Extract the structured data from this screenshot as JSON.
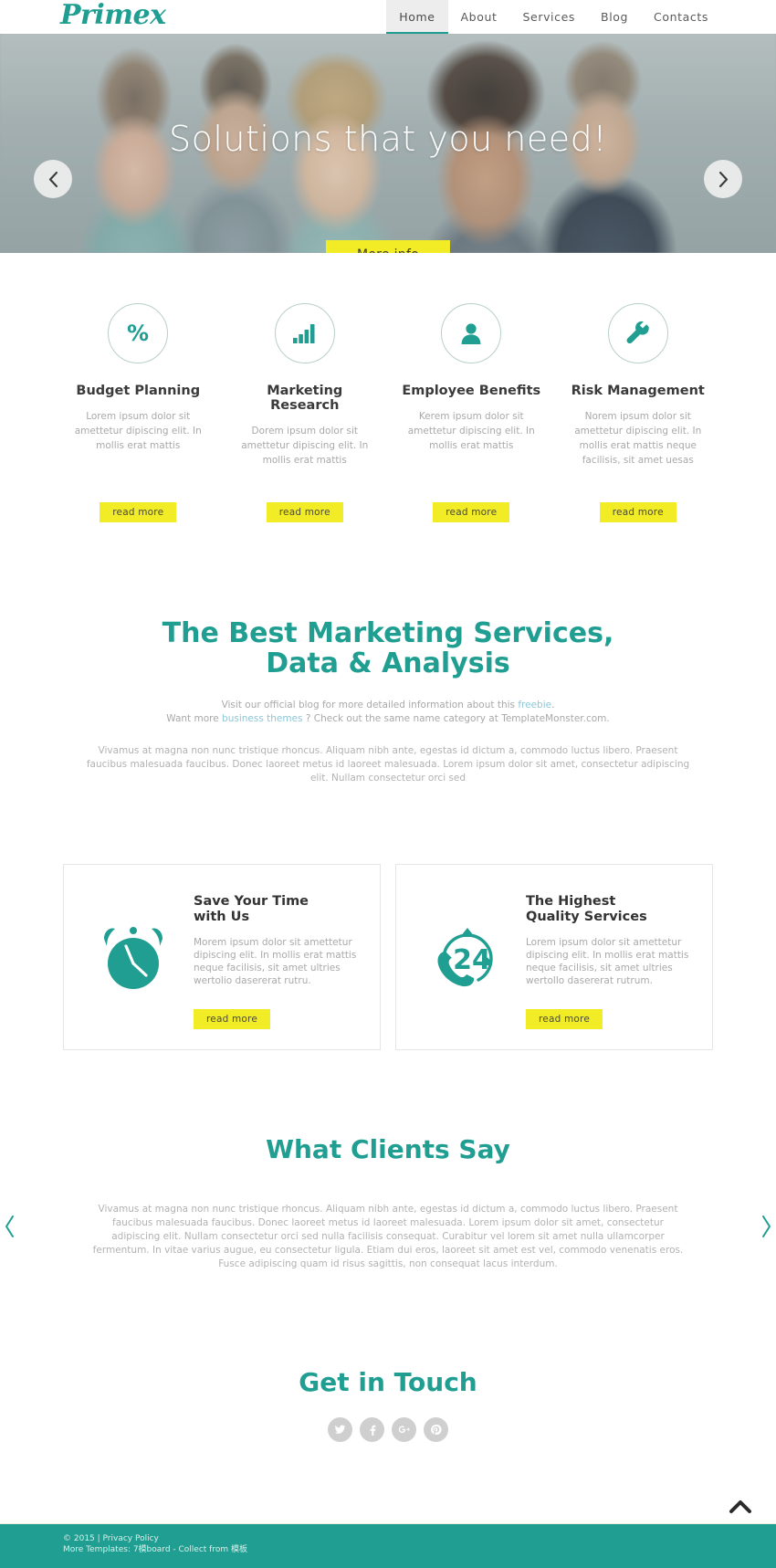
{
  "brand": {
    "name": "Primex",
    "accent_color": "#1f9e91",
    "yellow": "#f2ec26"
  },
  "nav": {
    "items": [
      {
        "label": "Home",
        "active": true
      },
      {
        "label": "About",
        "active": false
      },
      {
        "label": "Services",
        "active": false
      },
      {
        "label": "Blog",
        "active": false
      },
      {
        "label": "Contacts",
        "active": false
      }
    ]
  },
  "hero": {
    "title": "Solutions that you need!",
    "button": "More info",
    "prev_icon": "chevron-left-icon",
    "next_icon": "chevron-right-icon"
  },
  "features": {
    "read_more": "read more",
    "items": [
      {
        "icon": "percent-icon",
        "title": "Budget Planning",
        "text": "Lorem ipsum dolor sit amettetur dipiscing elit. In mollis erat mattis"
      },
      {
        "icon": "bar-chart-icon",
        "title": "Marketing Research",
        "text": "Dorem ipsum dolor sit amettetur dipiscing elit. In mollis erat mattis"
      },
      {
        "icon": "user-icon",
        "title": "Employee Benefits",
        "text": "Kerem ipsum dolor sit amettetur dipiscing elit. In mollis erat mattis"
      },
      {
        "icon": "wrench-icon",
        "title": "Risk Management",
        "text": "Norem ipsum dolor sit amettetur dipiscing elit. In mollis erat mattis neque facilisis, sit amet uesas"
      }
    ]
  },
  "best": {
    "title_line1": "The Best Marketing Services,",
    "title_line2": "Data & Analysis",
    "links_line1_pre": "Visit our official blog for more detailed information about this ",
    "links_line1_link": "freebie",
    "links_line1_post": ".",
    "links_line2_pre": "Want more ",
    "links_line2_link": "business themes",
    "links_line2_post": " ? Check out the same name category at TemplateMonster.com.",
    "paragraph": "Vivamus at magna non nunc tristique rhoncus. Aliquam nibh ante, egestas id dictum a, commodo luctus libero. Praesent faucibus malesuada faucibus. Donec laoreet metus id laoreet malesuada. Lorem ipsum dolor sit amet, consectetur adipiscing elit. Nullam consectetur orci sed"
  },
  "cards": {
    "read_more": "read more",
    "items": [
      {
        "icon": "alarm-clock-icon",
        "title_line1": "Save Your Time",
        "title_line2": "with Us",
        "text": "Morem ipsum dolor sit amettetur dipiscing elit. In mollis erat mattis neque facilisis, sit amet ultries wertolio dasererat rutru."
      },
      {
        "icon": "phone-24-icon",
        "title_line1": "The Highest",
        "title_line2": "Quality Services",
        "text": "Lorem ipsum dolor sit amettetur dipiscing elit. In mollis erat mattis neque facilisis, sit amet ultries wertollo dasererat rutrum."
      }
    ]
  },
  "testimonials": {
    "title": "What Clients Say",
    "text": "Vivamus at magna non nunc tristique rhoncus. Aliquam nibh ante, egestas id dictum a, commodo luctus libero. Praesent faucibus malesuada faucibus. Donec laoreet metus id laoreet malesuada. Lorem ipsum dolor sit amet, consectetur adipiscing elit. Nullam consectetur orci sed nulla facilisis consequat. Curabitur vel lorem sit amet nulla ullamcorper fermentum. In vitae varius augue, eu consectetur ligula. Etiam dui eros, laoreet sit amet est vel, commodo venenatis eros. Fusce adipiscing quam id risus sagittis, non consequat lacus interdum.",
    "prev_icon": "chevron-left-icon",
    "next_icon": "chevron-right-icon"
  },
  "touch": {
    "title": "Get in Touch",
    "socials": [
      {
        "name": "twitter-icon",
        "label": "Twitter"
      },
      {
        "name": "facebook-icon",
        "label": "Facebook"
      },
      {
        "name": "google-plus-icon",
        "label": "Google Plus"
      },
      {
        "name": "pinterest-icon",
        "label": "Pinterest"
      }
    ]
  },
  "to_top": {
    "icon": "chevron-up-icon"
  },
  "footer": {
    "copyright": "© 2015 | ",
    "privacy_link": "Privacy Policy",
    "more_templates": "More Templates: 7模board - Collect from 模板"
  }
}
